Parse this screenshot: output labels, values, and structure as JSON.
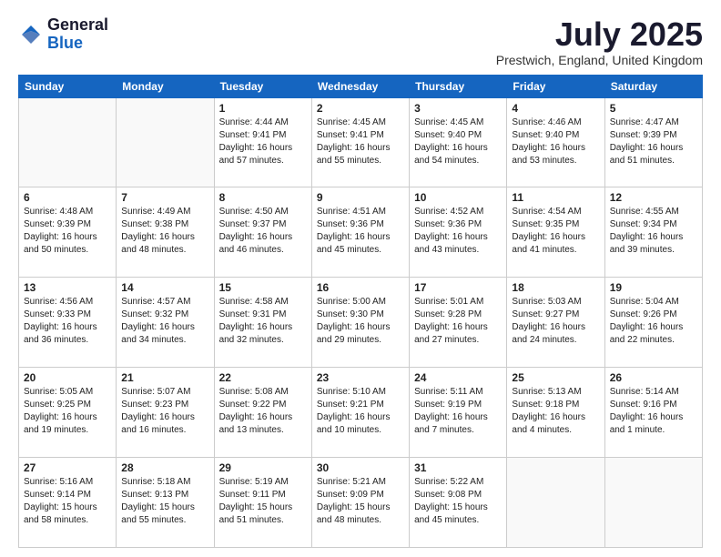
{
  "logo": {
    "general": "General",
    "blue": "Blue"
  },
  "title": "July 2025",
  "location": "Prestwich, England, United Kingdom",
  "weekdays": [
    "Sunday",
    "Monday",
    "Tuesday",
    "Wednesday",
    "Thursday",
    "Friday",
    "Saturday"
  ],
  "weeks": [
    [
      {
        "day": "",
        "sunrise": "",
        "sunset": "",
        "daylight": ""
      },
      {
        "day": "",
        "sunrise": "",
        "sunset": "",
        "daylight": ""
      },
      {
        "day": "1",
        "sunrise": "Sunrise: 4:44 AM",
        "sunset": "Sunset: 9:41 PM",
        "daylight": "Daylight: 16 hours and 57 minutes."
      },
      {
        "day": "2",
        "sunrise": "Sunrise: 4:45 AM",
        "sunset": "Sunset: 9:41 PM",
        "daylight": "Daylight: 16 hours and 55 minutes."
      },
      {
        "day": "3",
        "sunrise": "Sunrise: 4:45 AM",
        "sunset": "Sunset: 9:40 PM",
        "daylight": "Daylight: 16 hours and 54 minutes."
      },
      {
        "day": "4",
        "sunrise": "Sunrise: 4:46 AM",
        "sunset": "Sunset: 9:40 PM",
        "daylight": "Daylight: 16 hours and 53 minutes."
      },
      {
        "day": "5",
        "sunrise": "Sunrise: 4:47 AM",
        "sunset": "Sunset: 9:39 PM",
        "daylight": "Daylight: 16 hours and 51 minutes."
      }
    ],
    [
      {
        "day": "6",
        "sunrise": "Sunrise: 4:48 AM",
        "sunset": "Sunset: 9:39 PM",
        "daylight": "Daylight: 16 hours and 50 minutes."
      },
      {
        "day": "7",
        "sunrise": "Sunrise: 4:49 AM",
        "sunset": "Sunset: 9:38 PM",
        "daylight": "Daylight: 16 hours and 48 minutes."
      },
      {
        "day": "8",
        "sunrise": "Sunrise: 4:50 AM",
        "sunset": "Sunset: 9:37 PM",
        "daylight": "Daylight: 16 hours and 46 minutes."
      },
      {
        "day": "9",
        "sunrise": "Sunrise: 4:51 AM",
        "sunset": "Sunset: 9:36 PM",
        "daylight": "Daylight: 16 hours and 45 minutes."
      },
      {
        "day": "10",
        "sunrise": "Sunrise: 4:52 AM",
        "sunset": "Sunset: 9:36 PM",
        "daylight": "Daylight: 16 hours and 43 minutes."
      },
      {
        "day": "11",
        "sunrise": "Sunrise: 4:54 AM",
        "sunset": "Sunset: 9:35 PM",
        "daylight": "Daylight: 16 hours and 41 minutes."
      },
      {
        "day": "12",
        "sunrise": "Sunrise: 4:55 AM",
        "sunset": "Sunset: 9:34 PM",
        "daylight": "Daylight: 16 hours and 39 minutes."
      }
    ],
    [
      {
        "day": "13",
        "sunrise": "Sunrise: 4:56 AM",
        "sunset": "Sunset: 9:33 PM",
        "daylight": "Daylight: 16 hours and 36 minutes."
      },
      {
        "day": "14",
        "sunrise": "Sunrise: 4:57 AM",
        "sunset": "Sunset: 9:32 PM",
        "daylight": "Daylight: 16 hours and 34 minutes."
      },
      {
        "day": "15",
        "sunrise": "Sunrise: 4:58 AM",
        "sunset": "Sunset: 9:31 PM",
        "daylight": "Daylight: 16 hours and 32 minutes."
      },
      {
        "day": "16",
        "sunrise": "Sunrise: 5:00 AM",
        "sunset": "Sunset: 9:30 PM",
        "daylight": "Daylight: 16 hours and 29 minutes."
      },
      {
        "day": "17",
        "sunrise": "Sunrise: 5:01 AM",
        "sunset": "Sunset: 9:28 PM",
        "daylight": "Daylight: 16 hours and 27 minutes."
      },
      {
        "day": "18",
        "sunrise": "Sunrise: 5:03 AM",
        "sunset": "Sunset: 9:27 PM",
        "daylight": "Daylight: 16 hours and 24 minutes."
      },
      {
        "day": "19",
        "sunrise": "Sunrise: 5:04 AM",
        "sunset": "Sunset: 9:26 PM",
        "daylight": "Daylight: 16 hours and 22 minutes."
      }
    ],
    [
      {
        "day": "20",
        "sunrise": "Sunrise: 5:05 AM",
        "sunset": "Sunset: 9:25 PM",
        "daylight": "Daylight: 16 hours and 19 minutes."
      },
      {
        "day": "21",
        "sunrise": "Sunrise: 5:07 AM",
        "sunset": "Sunset: 9:23 PM",
        "daylight": "Daylight: 16 hours and 16 minutes."
      },
      {
        "day": "22",
        "sunrise": "Sunrise: 5:08 AM",
        "sunset": "Sunset: 9:22 PM",
        "daylight": "Daylight: 16 hours and 13 minutes."
      },
      {
        "day": "23",
        "sunrise": "Sunrise: 5:10 AM",
        "sunset": "Sunset: 9:21 PM",
        "daylight": "Daylight: 16 hours and 10 minutes."
      },
      {
        "day": "24",
        "sunrise": "Sunrise: 5:11 AM",
        "sunset": "Sunset: 9:19 PM",
        "daylight": "Daylight: 16 hours and 7 minutes."
      },
      {
        "day": "25",
        "sunrise": "Sunrise: 5:13 AM",
        "sunset": "Sunset: 9:18 PM",
        "daylight": "Daylight: 16 hours and 4 minutes."
      },
      {
        "day": "26",
        "sunrise": "Sunrise: 5:14 AM",
        "sunset": "Sunset: 9:16 PM",
        "daylight": "Daylight: 16 hours and 1 minute."
      }
    ],
    [
      {
        "day": "27",
        "sunrise": "Sunrise: 5:16 AM",
        "sunset": "Sunset: 9:14 PM",
        "daylight": "Daylight: 15 hours and 58 minutes."
      },
      {
        "day": "28",
        "sunrise": "Sunrise: 5:18 AM",
        "sunset": "Sunset: 9:13 PM",
        "daylight": "Daylight: 15 hours and 55 minutes."
      },
      {
        "day": "29",
        "sunrise": "Sunrise: 5:19 AM",
        "sunset": "Sunset: 9:11 PM",
        "daylight": "Daylight: 15 hours and 51 minutes."
      },
      {
        "day": "30",
        "sunrise": "Sunrise: 5:21 AM",
        "sunset": "Sunset: 9:09 PM",
        "daylight": "Daylight: 15 hours and 48 minutes."
      },
      {
        "day": "31",
        "sunrise": "Sunrise: 5:22 AM",
        "sunset": "Sunset: 9:08 PM",
        "daylight": "Daylight: 15 hours and 45 minutes."
      },
      {
        "day": "",
        "sunrise": "",
        "sunset": "",
        "daylight": ""
      },
      {
        "day": "",
        "sunrise": "",
        "sunset": "",
        "daylight": ""
      }
    ]
  ]
}
